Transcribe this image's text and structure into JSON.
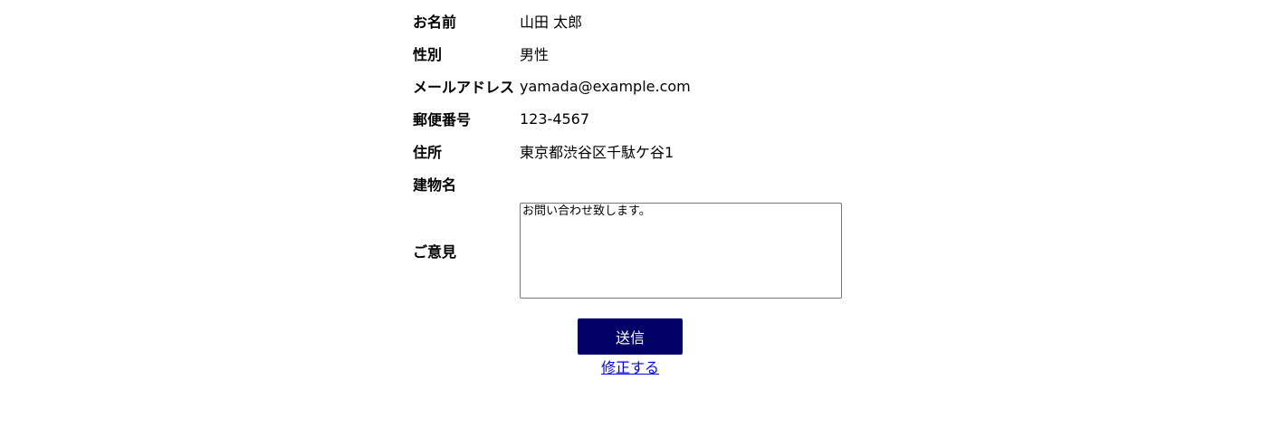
{
  "form": {
    "fields": [
      {
        "label": "お名前",
        "value": "山田 太郎"
      },
      {
        "label": "性別",
        "value": "男性"
      },
      {
        "label": "メールアドレス",
        "value": "yamada@example.com"
      },
      {
        "label": "郵便番号",
        "value": "123-4567"
      },
      {
        "label": "住所",
        "value": "東京都渋谷区千駄ケ谷1"
      },
      {
        "label": "建物名",
        "value": ""
      }
    ],
    "opinion": {
      "label": "ご意見",
      "value": "お問い合わせ致します。"
    }
  },
  "actions": {
    "submit_label": "送信",
    "edit_label": "修正する"
  },
  "colors": {
    "submit_bg": "#000066",
    "link": "#0000ee"
  }
}
